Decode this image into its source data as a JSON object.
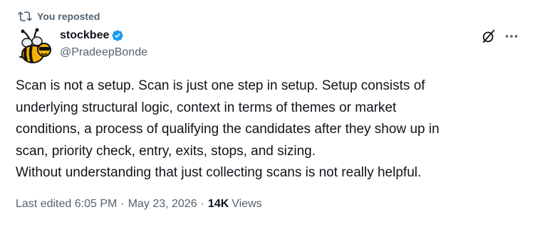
{
  "repost": {
    "text": "You reposted"
  },
  "author": {
    "name": "stockbee",
    "handle": "@PradeepBonde"
  },
  "tweet": {
    "lines": [
      "Scan is not a setup. Scan is just one step in setup. Setup consists of",
      "underlying structural logic, context in terms of themes or market",
      "conditions,  a process of qualifying the candidates after they show up in",
      "scan, priority check, entry, exits, stops, and sizing.",
      "Without understanding that just collecting scans is not really helpful."
    ]
  },
  "meta": {
    "edited": "Last edited 6:05 PM",
    "date": "May 23, 2026",
    "separator": "·",
    "views_count": "14K",
    "views_label": "Views"
  },
  "colors": {
    "primary_text": "#0f1419",
    "secondary_text": "#536471",
    "verified_blue": "#1d9bf0"
  },
  "icons": {
    "repost": "repost-icon",
    "verified": "verified-badge-icon",
    "grok": "grok-icon",
    "more": "more-icon"
  }
}
